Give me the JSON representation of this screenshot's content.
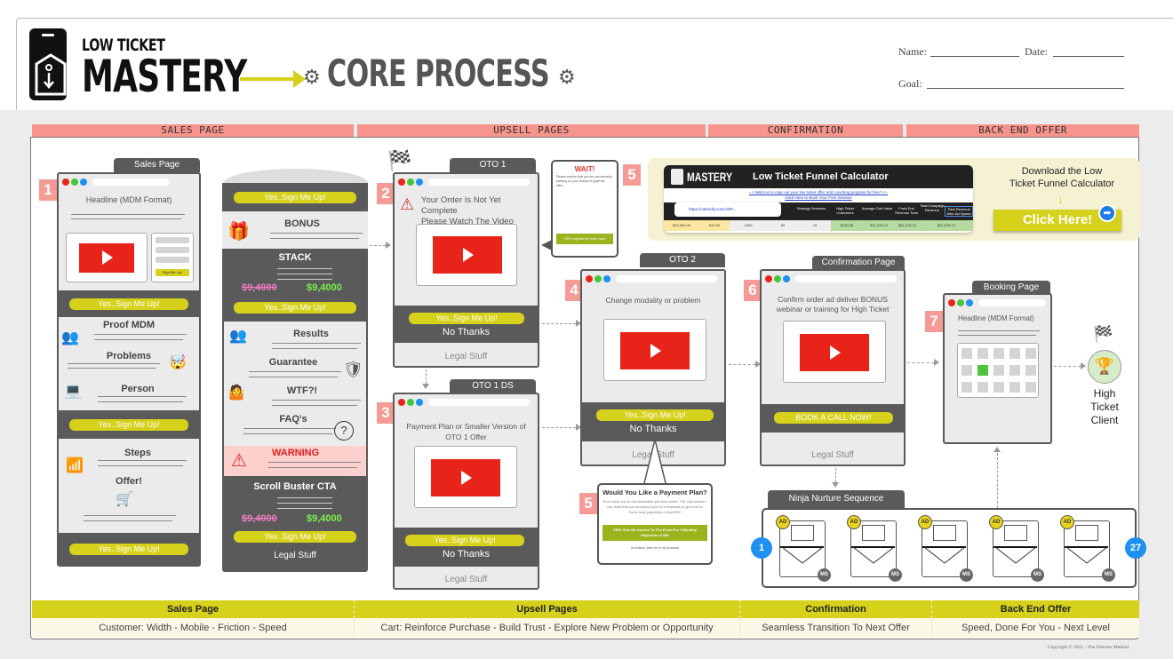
{
  "header": {
    "brand_line1": "LOW TICKET",
    "brand_line2": "MASTERY",
    "title": "CORE PROCESS",
    "name_label": "Name:",
    "date_label": "Date:",
    "goal_label": "Goal:"
  },
  "phases": [
    "SALES PAGE",
    "UPSELL PAGES",
    "CONFIRMATION",
    "BACK END OFFER"
  ],
  "sales_page": {
    "step": "1",
    "tab": "Sales Page",
    "headline": "Headline (MDM Format)",
    "side_cta": "Sign Me Up!",
    "cta": "Yes..Sign Me Up!",
    "sections": [
      "Proof MDM",
      "Problems",
      "Person",
      "Steps",
      "Offer!"
    ]
  },
  "long_page": {
    "cta": "Yes..Sign Me Up!",
    "bonus": "BONUS",
    "stack": "STACK",
    "price_old": "$9,4000",
    "price_new": "$9,4000",
    "results": "Results",
    "guarantee": "Guarantee",
    "wtf": "WTF?!",
    "faq": "FAQ's",
    "warning": "WARNING",
    "scroll_buster": "Scroll Buster CTA",
    "legal": "Legal Stuff"
  },
  "oto1": {
    "step": "2",
    "tab": "OTO 1",
    "headline_line1": "Your Order Is Not Yet Complete",
    "headline_line2": "Please Watch The Video Below",
    "cta": "Yes..Sign Me Up!",
    "no_thanks": "No Thanks",
    "legal": "Legal Stuff"
  },
  "wait_popup": {
    "step": "5",
    "title": "WAIT!",
    "body": "Please confirm that you are permanently passing on your chance to grab the offer...",
    "button": "YES! Upgrade My Order Now!"
  },
  "oto1ds": {
    "step": "3",
    "tab": "OTO 1 DS",
    "headline_line1": "Payment Plan or Smaller Version of",
    "headline_line2": "OTO 1 Offer",
    "cta": "Yes..Sign Me Up!",
    "no_thanks": "No Thanks",
    "legal": "Legal Stuff"
  },
  "oto2": {
    "step": "4",
    "tab": "OTO 2",
    "headline": "Change modality or problem",
    "cta": "Yes..Sign Me Up!",
    "no_thanks": "No Thanks",
    "legal": "Legal Stuff"
  },
  "payment_popup": {
    "step": "5",
    "title": "Would You Like a Payment Plan?",
    "body": "Don't miss out on this incredible one time event. The only reason I can think that you would not join us is financial so go here for three easy payments of just $99!",
    "button": "YES! Give Me Access To The Event For 3 Monthly Payments of $99",
    "decline": "No thanks, take me to my products"
  },
  "calculator": {
    "brand": "MASTERY",
    "title": "Low Ticket Funnel Calculator",
    "link1": "--> Want us to map out your low ticket offer and coaching program for free? <--",
    "link2": "Click Here to Book Your Free Session",
    "url": "https://calendly.com/c/DF...",
    "columns": [
      "Strategy Sessions",
      "High Ticket Customers",
      "Average Cart Value",
      "Front End Revenue Total",
      "Total Campaign Revenue",
      "Total Revenue After Ad Spend"
    ],
    "values": [
      "$10,000.00",
      "$10.00",
      "1000",
      "50",
      "10",
      "$233.56",
      "$11,678.13",
      "$61,678.13",
      "$51,678.13"
    ],
    "download_line1": "Download the Low",
    "download_line2": "Ticket Funnel Calculator",
    "click_here": "Click Here!"
  },
  "confirmation": {
    "step": "6",
    "tab": "Confirmation Page",
    "headline_line1": "Confirm order ad deliver BONUS",
    "headline_line2": "webinar or training for High Ticket",
    "cta": "BOOK A CALL NOW!",
    "legal": "Legal Stuff"
  },
  "booking": {
    "step": "7",
    "tab": "Booking  Page",
    "headline": "Headline (MDM Format)"
  },
  "client": {
    "line1": "High",
    "line2": "Ticket",
    "line3": "Client"
  },
  "nurture": {
    "tab": "Ninja Nurture Sequence",
    "start": "1",
    "end": "27",
    "ad_badge": "AD",
    "ms_badge": "MS"
  },
  "footer": {
    "heads": [
      "Sales Page",
      "Upsell Pages",
      "Confirmation",
      "Back End Offer"
    ],
    "rows": [
      "Customer: Width - Mobile - Friction - Speed",
      "Cart: Reinforce Purchase - Build Trust - Explore New Problem or Opportunity",
      "Seamless Transition To Next Offer",
      "Speed, Done For You - Next Level"
    ],
    "copyright": "Copyright © 2021 - The Fletcher Method"
  },
  "colors": {
    "accent_yellow": "#d6d11a",
    "phase_pink": "#f7948c",
    "video_red": "#e8241a",
    "dark_gray": "#5a5a5a"
  }
}
